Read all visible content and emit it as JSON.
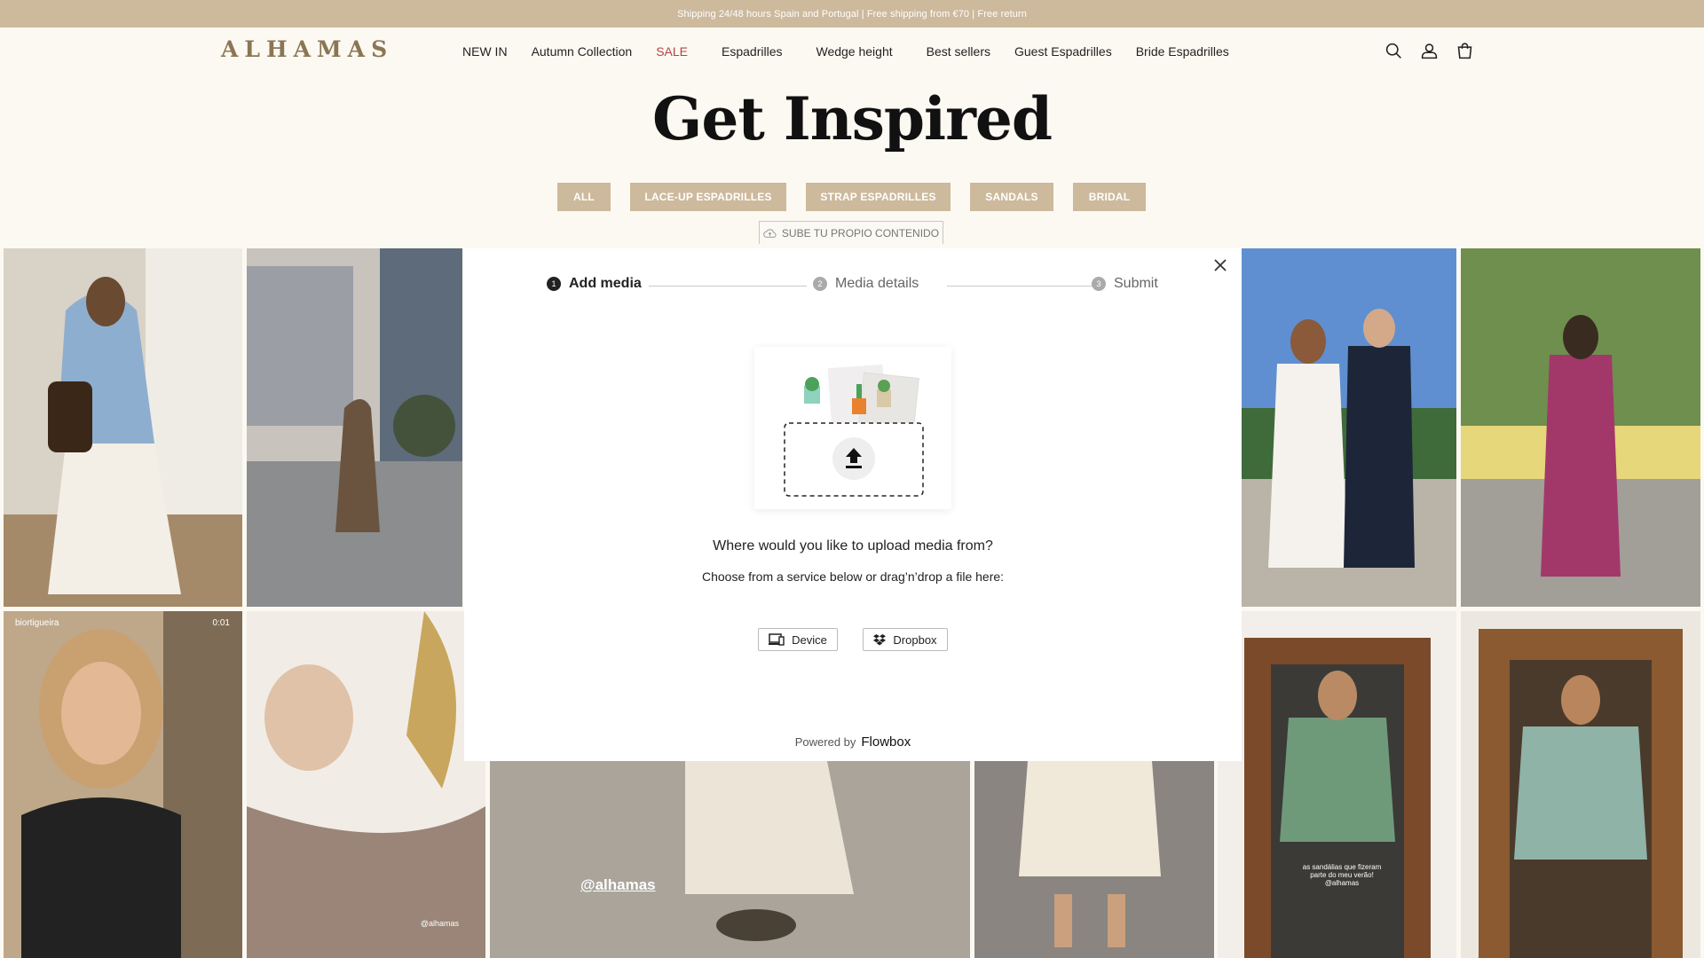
{
  "announcement": "Shipping 24/48 hours Spain and Portugal | Free shipping from €70 | Free return",
  "logo": "ALHAMAS",
  "nav": [
    {
      "label": "NEW IN"
    },
    {
      "label": "Autumn Collection"
    },
    {
      "label": "SALE"
    },
    {
      "label": "Espadrilles"
    },
    {
      "label": "Wedge height"
    },
    {
      "label": "Best sellers"
    },
    {
      "label": "Guest Espadrilles"
    },
    {
      "label": "Bride Espadrilles"
    }
  ],
  "header_icons": [
    "search-icon",
    "account-icon",
    "cart-icon"
  ],
  "page_title": "Get Inspired",
  "filters": [
    "ALL",
    "LACE-UP ESPADRILLES",
    "STRAP ESPADRILLES",
    "SANDALS",
    "BRIDAL"
  ],
  "upload_own_label": "SUBE TU PROPIO CONTENIDO",
  "modal": {
    "steps": [
      {
        "num": "1",
        "label": "Add media",
        "active": true
      },
      {
        "num": "2",
        "label": "Media details",
        "active": false
      },
      {
        "num": "3",
        "label": "Submit",
        "active": false
      }
    ],
    "question": "Where would you like to upload media from?",
    "instruction": "Choose from a service below or drag’n’drop a file here:",
    "services": [
      {
        "label": "Device",
        "icon": "device-icon"
      },
      {
        "label": "Dropbox",
        "icon": "dropbox-icon"
      }
    ],
    "powered_by": "Powered by",
    "powered_brand": "Flowbox"
  },
  "photo_overlays": {
    "user": "biortigueira",
    "duration": "0:01",
    "watermark_small": "@alhamas",
    "watermark_large": "@alhamas",
    "caption": "as sandálias que fizeram parte do meu verão! @alhamas"
  },
  "colors": {
    "announcement_bg": "#cdb99c",
    "filter_bg": "#cdb99c",
    "page_bg": "#fcf9f2",
    "sale": "#b14646",
    "logo": "#8a7654"
  }
}
